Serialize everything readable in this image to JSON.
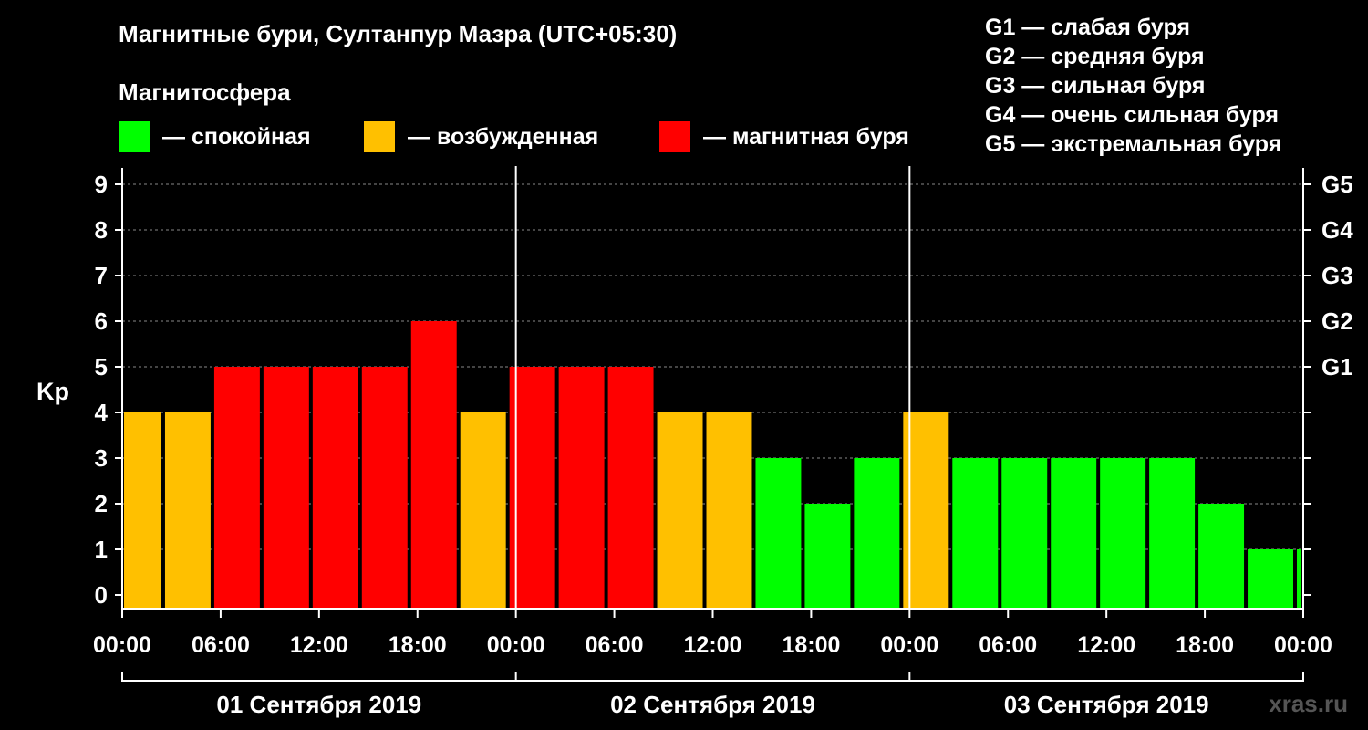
{
  "title": "Магнитные бури, Султанпур Мазра (UTC+05:30)",
  "magnetosphere": {
    "title": "Магнитосфера",
    "legend": [
      {
        "label": "— спокойная",
        "color": "#00ff00"
      },
      {
        "label": "— возбужденная",
        "color": "#ffc000"
      },
      {
        "label": "— магнитная буря",
        "color": "#ff0000"
      }
    ]
  },
  "storm_levels": [
    "G1 — слабая буря",
    "G2 — средняя буря",
    "G3 — сильная буря",
    "G4 — очень сильная буря",
    "G5 — экстремальная буря"
  ],
  "watermark": "xras.ru",
  "colors": {
    "quiet": "#00ff00",
    "active": "#ffc000",
    "storm": "#ff0000"
  },
  "chart_data": {
    "type": "bar",
    "ylabel": "Kp",
    "ylim": [
      0,
      9
    ],
    "y_ticks": [
      "0",
      "1",
      "2",
      "3",
      "4",
      "5",
      "6",
      "7",
      "8",
      "9"
    ],
    "right_ticks": [
      {
        "value": 5,
        "label": "G1"
      },
      {
        "value": 6,
        "label": "G2"
      },
      {
        "value": 7,
        "label": "G3"
      },
      {
        "value": 8,
        "label": "G4"
      },
      {
        "value": 9,
        "label": "G5"
      }
    ],
    "x_range_hours": [
      0,
      72
    ],
    "x_tick_labels": [
      "00:00",
      "06:00",
      "12:00",
      "18:00",
      "00:00",
      "06:00",
      "12:00",
      "18:00",
      "00:00",
      "06:00",
      "12:00",
      "18:00",
      "00:00"
    ],
    "days": [
      "01 Сентября 2019",
      "02 Сентября 2019",
      "03 Сентября 2019"
    ],
    "grid": true,
    "bars": [
      {
        "start": 0,
        "end": 2.5,
        "value": 4
      },
      {
        "start": 2.5,
        "end": 5.5,
        "value": 4
      },
      {
        "start": 5.5,
        "end": 8.5,
        "value": 5
      },
      {
        "start": 8.5,
        "end": 11.5,
        "value": 5
      },
      {
        "start": 11.5,
        "end": 14.5,
        "value": 5
      },
      {
        "start": 14.5,
        "end": 17.5,
        "value": 5
      },
      {
        "start": 17.5,
        "end": 20.5,
        "value": 6
      },
      {
        "start": 20.5,
        "end": 23.5,
        "value": 4
      },
      {
        "start": 23.5,
        "end": 26.5,
        "value": 5
      },
      {
        "start": 26.5,
        "end": 29.5,
        "value": 5
      },
      {
        "start": 29.5,
        "end": 32.5,
        "value": 5
      },
      {
        "start": 32.5,
        "end": 35.5,
        "value": 4
      },
      {
        "start": 35.5,
        "end": 38.5,
        "value": 4
      },
      {
        "start": 38.5,
        "end": 41.5,
        "value": 3
      },
      {
        "start": 41.5,
        "end": 44.5,
        "value": 2
      },
      {
        "start": 44.5,
        "end": 47.5,
        "value": 3
      },
      {
        "start": 47.5,
        "end": 50.5,
        "value": 4
      },
      {
        "start": 50.5,
        "end": 53.5,
        "value": 3
      },
      {
        "start": 53.5,
        "end": 56.5,
        "value": 3
      },
      {
        "start": 56.5,
        "end": 59.5,
        "value": 3
      },
      {
        "start": 59.5,
        "end": 62.5,
        "value": 3
      },
      {
        "start": 62.5,
        "end": 65.5,
        "value": 3
      },
      {
        "start": 65.5,
        "end": 68.5,
        "value": 2
      },
      {
        "start": 68.5,
        "end": 71.5,
        "value": 1
      },
      {
        "start": 71.5,
        "end": 72,
        "value": 1
      }
    ]
  }
}
